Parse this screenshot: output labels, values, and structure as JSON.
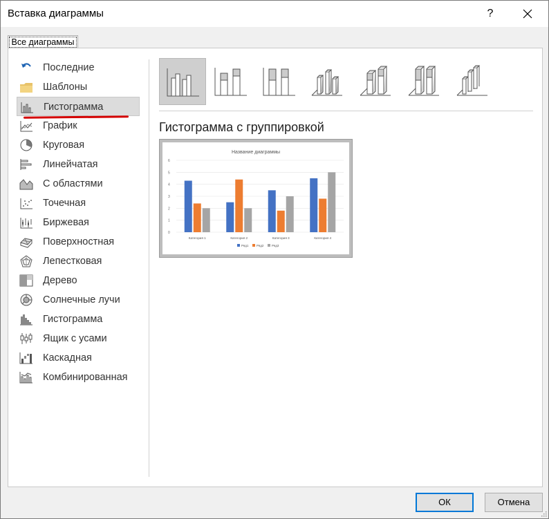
{
  "window": {
    "title": "Вставка диаграммы",
    "help": "?"
  },
  "tab": {
    "label": "Все диаграммы"
  },
  "sidebar": {
    "selected_index": 2,
    "items": [
      {
        "label": "Последние",
        "icon": "recent-icon"
      },
      {
        "label": "Шаблоны",
        "icon": "folder-icon"
      },
      {
        "label": "Гистограмма",
        "icon": "column-chart-icon"
      },
      {
        "label": "График",
        "icon": "line-chart-icon"
      },
      {
        "label": "Круговая",
        "icon": "pie-chart-icon"
      },
      {
        "label": "Линейчатая",
        "icon": "bar-chart-icon"
      },
      {
        "label": "С областями",
        "icon": "area-chart-icon"
      },
      {
        "label": "Точечная",
        "icon": "scatter-chart-icon"
      },
      {
        "label": "Биржевая",
        "icon": "stock-chart-icon"
      },
      {
        "label": "Поверхностная",
        "icon": "surface-chart-icon"
      },
      {
        "label": "Лепестковая",
        "icon": "radar-chart-icon"
      },
      {
        "label": "Дерево",
        "icon": "treemap-chart-icon"
      },
      {
        "label": "Солнечные лучи",
        "icon": "sunburst-chart-icon"
      },
      {
        "label": "Гистограмма",
        "icon": "histogram-chart-icon"
      },
      {
        "label": "Ящик с усами",
        "icon": "box-whisker-chart-icon"
      },
      {
        "label": "Каскадная",
        "icon": "waterfall-chart-icon"
      },
      {
        "label": "Комбинированная",
        "icon": "combo-chart-icon"
      }
    ]
  },
  "subtypes": {
    "selected_index": 0,
    "items": [
      {
        "icon": "clustered-column-icon"
      },
      {
        "icon": "stacked-column-icon"
      },
      {
        "icon": "stacked-100-column-icon"
      },
      {
        "icon": "3d-clustered-column-icon"
      },
      {
        "icon": "3d-stacked-column-icon"
      },
      {
        "icon": "3d-stacked-100-column-icon"
      },
      {
        "icon": "3d-column-icon"
      }
    ]
  },
  "subtype_title": "Гистограмма с группировкой",
  "chart_data": {
    "type": "bar",
    "title": "Название диаграммы",
    "categories": [
      "Категория 1",
      "Категория 2",
      "Категория 3",
      "Категория 4"
    ],
    "series": [
      {
        "name": "Ряд1",
        "values": [
          4.3,
          2.5,
          3.5,
          4.5
        ],
        "color": "#4472c4"
      },
      {
        "name": "Ряд2",
        "values": [
          2.4,
          4.4,
          1.8,
          2.8
        ],
        "color": "#ed7d31"
      },
      {
        "name": "Ряд3",
        "values": [
          2,
          2,
          3,
          5
        ],
        "color": "#a5a5a5"
      }
    ],
    "y_ticks": [
      "0",
      "1",
      "2",
      "3",
      "4",
      "5",
      "6"
    ],
    "ylim": [
      0,
      6
    ],
    "grid": true,
    "legend": "bottom"
  },
  "buttons": {
    "ok": "ОК",
    "cancel": "Отмена"
  }
}
